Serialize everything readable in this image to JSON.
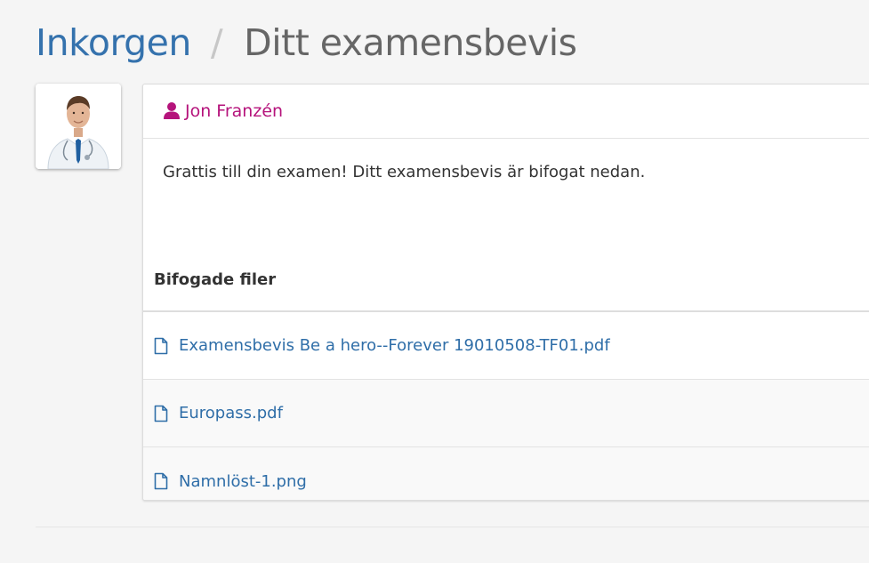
{
  "breadcrumb": {
    "parent": "Inkorgen",
    "separator": "/",
    "current": "Ditt examensbevis"
  },
  "message": {
    "sender": "Jon Franzén",
    "body": "Grattis till din examen! Ditt examensbevis är bifogat nedan.",
    "attachments_header": "Bifogade filer",
    "attachments": [
      {
        "name": "Examensbevis Be a hero--Forever 19010508-TF01.pdf",
        "icon": "file-icon"
      },
      {
        "name": "Europass.pdf",
        "icon": "file-icon"
      },
      {
        "name": "Namnlöst-1.png",
        "icon": "file-icon"
      }
    ]
  },
  "colors": {
    "link": "#3572ad",
    "sender": "#b5137b",
    "background": "#f5f5f5"
  }
}
